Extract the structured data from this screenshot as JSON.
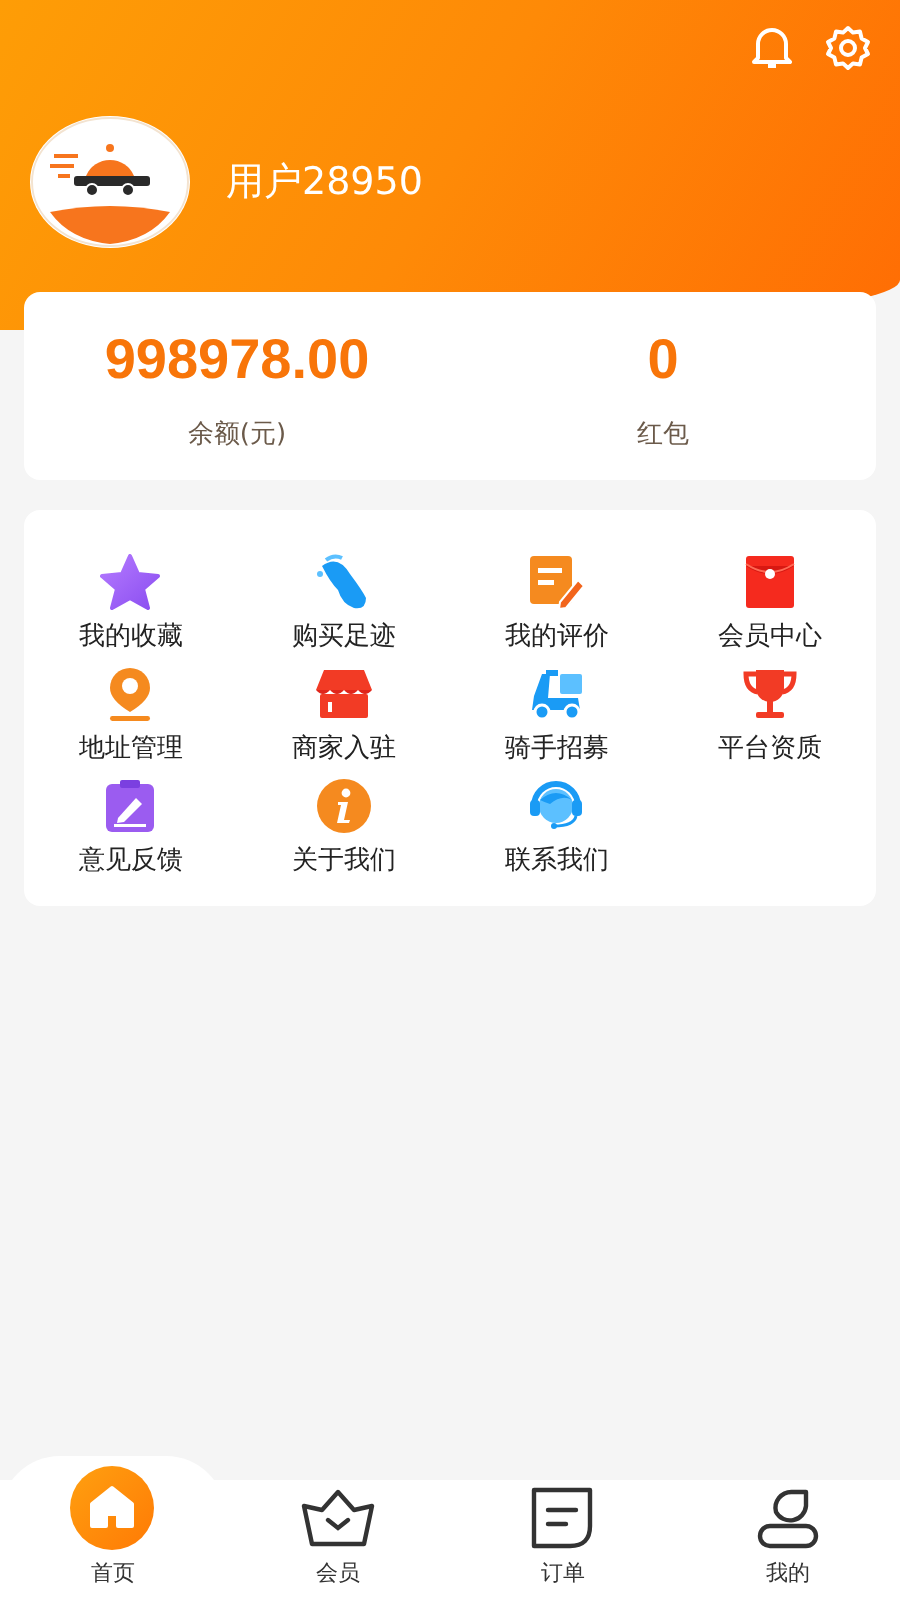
{
  "header": {
    "username": "用户28950"
  },
  "wallet": [
    {
      "value": "998978.00",
      "label": "余额(元)"
    },
    {
      "value": "0",
      "label": "红包"
    }
  ],
  "menu": [
    {
      "kind": "star",
      "label": "我的收藏"
    },
    {
      "kind": "footprint",
      "label": "购买足迹"
    },
    {
      "kind": "review",
      "label": "我的评价"
    },
    {
      "kind": "envelope",
      "label": "会员中心"
    },
    {
      "kind": "pin",
      "label": "地址管理"
    },
    {
      "kind": "shop",
      "label": "商家入驻"
    },
    {
      "kind": "scooter",
      "label": "骑手招募"
    },
    {
      "kind": "trophy",
      "label": "平台资质"
    },
    {
      "kind": "feedback",
      "label": "意见反馈"
    },
    {
      "kind": "info",
      "label": "关于我们"
    },
    {
      "kind": "headset",
      "label": "联系我们"
    }
  ],
  "tabs": [
    {
      "kind": "home",
      "label": "首页",
      "selected": true
    },
    {
      "kind": "crown",
      "label": "会员",
      "selected": false
    },
    {
      "kind": "order",
      "label": "订单",
      "selected": false
    },
    {
      "kind": "person",
      "label": "我的",
      "selected": false
    }
  ]
}
